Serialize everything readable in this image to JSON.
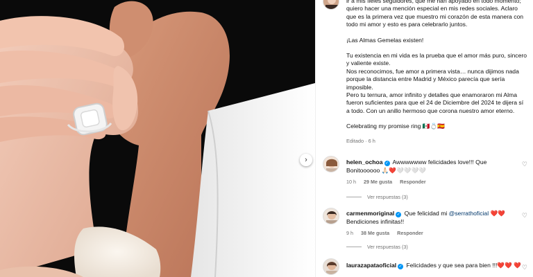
{
  "caption": {
    "line1": "ir a mis fieles seguidores, que me han apoyado en todo momento; quiero hacer una mención especial en mis redes sociales. Aclaro que es la primera vez que muestro mi corazón de esta manera con todo mi amor y esto es para celebrarlo juntos.",
    "line2": "¡Las Almas Gemelas existen!",
    "line3": "Tu existencia en mi vida es la prueba que el amor más puro, sincero y valiente existe.",
    "line4": "Nos reconocimos, fue amor a primera vista… nunca dijimos nada porque la distancia entre Madrid y México parecía que sería imposible.",
    "line5": "Pero tu ternura, amor infinito y detalles que enamoraron mi Alma fueron suficientes para que el 24 de Diciembre del 2024 te dijera sí a todo. Con un anillo hermoso que corona nuestro amor eterno.",
    "line6": "Celebrating my promise ring 🇲🇽💍🇪🇸",
    "edited": "Editado · 6 h"
  },
  "comments": [
    {
      "user": "helen_ochoa",
      "verified": true,
      "text": "Awwwwwww felicidades love!!! Que Bonitoooooo 🙏🏻❤️🤍🤍🤍🤍",
      "time": "10 h",
      "likes": "29 Me gusta",
      "reply": "Responder",
      "replies": "Ver respuestas (3)"
    },
    {
      "user": "carmenmoriginal",
      "verified": true,
      "text_pre": "Que felicidad mi ",
      "mention": "@serrathoficial",
      "text_post": " ❤️❤️ Bendiciones infinitas!!",
      "time": "9 h",
      "likes": "38 Me gusta",
      "reply": "Responder",
      "replies": "Ver respuestas (3)"
    },
    {
      "user": "laurazapataoficial",
      "verified": true,
      "text": "Felicidades y que sea para bien !!!❤️❤️ ❤️"
    }
  ],
  "icons": {
    "next": "chevron-right-icon",
    "like": "heart-outline-icon"
  },
  "colors": {
    "verified": "#0095f6",
    "heart": "#e0245e",
    "muted": "#737373",
    "photo_bg": "#0b0b0b"
  },
  "ui": {
    "next_glyph": "›",
    "heart_glyph": "♡"
  }
}
